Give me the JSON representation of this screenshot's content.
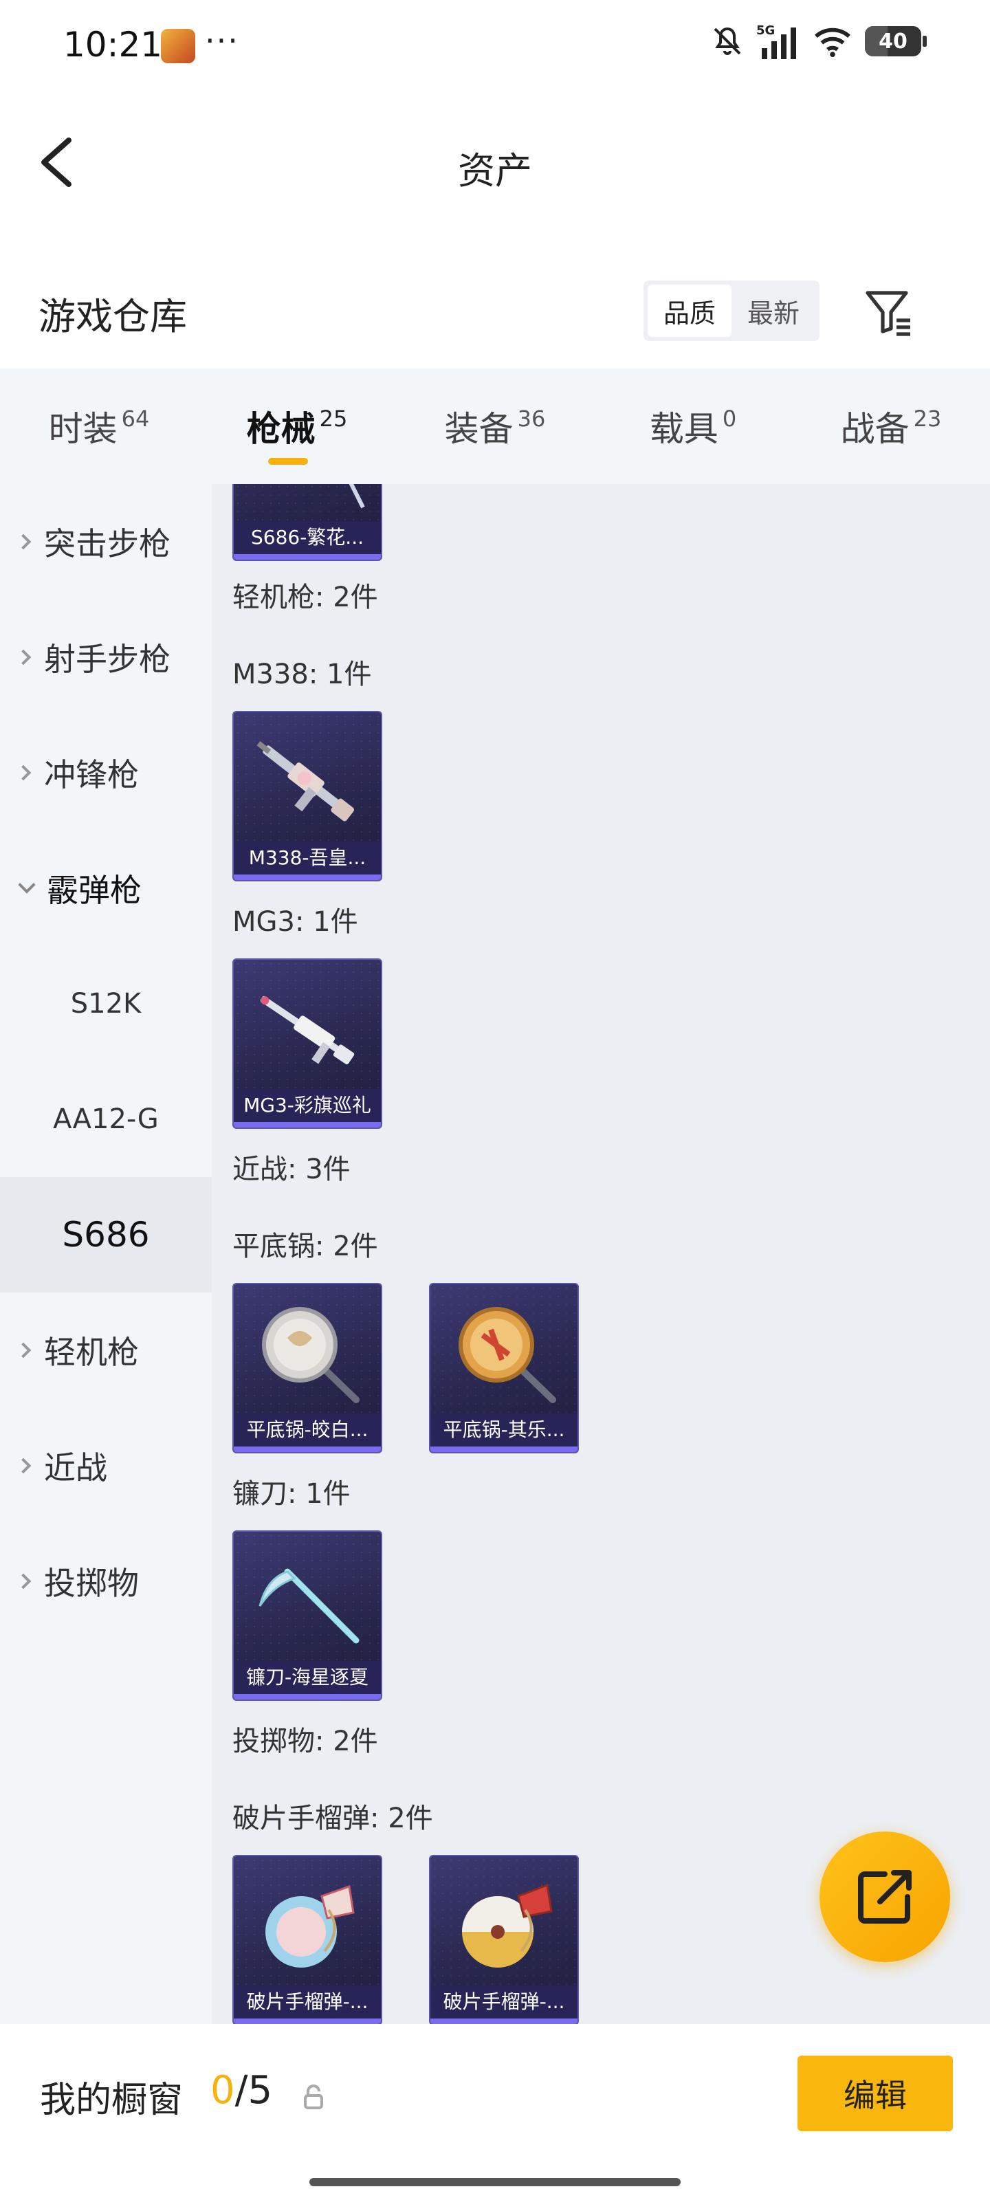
{
  "status_bar": {
    "time": "10:21",
    "dots": "···",
    "network": "5G",
    "battery": "40",
    "battery_level": 40
  },
  "header": {
    "title": "资产"
  },
  "subheader": {
    "title": "游戏仓库",
    "sort_options": [
      "品质",
      "最新"
    ],
    "sort_active": "品质"
  },
  "tabs": [
    {
      "label": "时装",
      "count": "64"
    },
    {
      "label": "枪械",
      "count": "25",
      "active": true
    },
    {
      "label": "装备",
      "count": "36"
    },
    {
      "label": "载具",
      "count": "0"
    },
    {
      "label": "战备",
      "count": "23"
    }
  ],
  "sidebar": {
    "items": [
      {
        "label": "突击步枪",
        "type": "collapsed"
      },
      {
        "label": "射手步枪",
        "type": "collapsed"
      },
      {
        "label": "冲锋枪",
        "type": "collapsed"
      },
      {
        "label": "霰弹枪",
        "type": "expanded"
      },
      {
        "label": "S12K",
        "type": "sub"
      },
      {
        "label": "AA12-G",
        "type": "sub"
      },
      {
        "label": "S686",
        "type": "sub-selected"
      },
      {
        "label": "轻机枪",
        "type": "collapsed"
      },
      {
        "label": "近战",
        "type": "collapsed"
      },
      {
        "label": "投掷物",
        "type": "collapsed"
      }
    ]
  },
  "main": {
    "partial_card": "S686-繁花...",
    "labels": {
      "lmg": "轻机枪: 2件",
      "m338": "M338: 1件",
      "mg3": "MG3: 1件",
      "melee": "近战: 3件",
      "pan": "平底锅: 2件",
      "sickle": "镰刀: 1件",
      "throwable": "投掷物: 2件",
      "frag": "破片手榴弹: 2件"
    },
    "cards": {
      "m338": "M338-吾皇...",
      "mg3": "MG3-彩旗巡礼",
      "pan1": "平底锅-皎白...",
      "pan2": "平底锅-其乐...",
      "sickle": "镰刀-海星逐夏",
      "frag1": "破片手榴弹-...",
      "frag2": "破片手榴弹-..."
    }
  },
  "bottom_bar": {
    "label": "我的橱窗",
    "count_current": "0",
    "count_total": "/5",
    "edit_label": "编辑"
  },
  "colors": {
    "accent": "#f5b10d",
    "card_bg": "#2b2952",
    "card_bar": "#7a6cf0"
  }
}
